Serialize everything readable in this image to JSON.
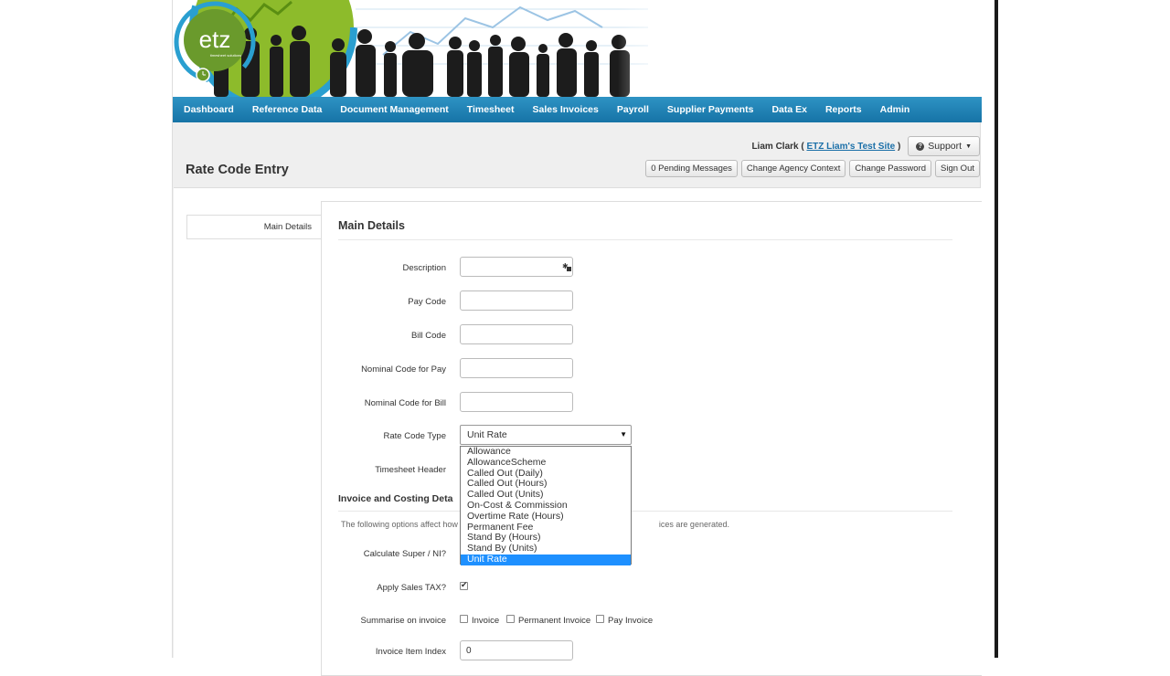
{
  "nav": {
    "items": [
      "Dashboard",
      "Reference Data",
      "Document Management",
      "Timesheet",
      "Sales Invoices",
      "Payroll",
      "Supplier Payments",
      "Data Ex",
      "Reports",
      "Admin"
    ]
  },
  "logo": {
    "text": "etz",
    "tagline": "timesheet solutions"
  },
  "user": {
    "name": "Liam Clark (",
    "site": "ETZ Liam's Test Site",
    "close": ")",
    "support_label": "Support"
  },
  "toolbar": {
    "pending_messages": "0 Pending Messages",
    "change_agency": "Change Agency Context",
    "change_password": "Change Password",
    "sign_out": "Sign Out"
  },
  "page_title": "Rate Code Entry",
  "tab": {
    "main_details": "Main Details"
  },
  "main_details": {
    "heading": "Main Details",
    "fields": {
      "description": {
        "label": "Description",
        "value": ""
      },
      "pay_code": {
        "label": "Pay Code",
        "value": ""
      },
      "bill_code": {
        "label": "Bill Code",
        "value": ""
      },
      "nominal_pay": {
        "label": "Nominal Code for Pay",
        "value": ""
      },
      "nominal_bill": {
        "label": "Nominal Code for Bill",
        "value": ""
      },
      "rate_code_type": {
        "label": "Rate Code Type",
        "value": "Unit Rate"
      },
      "timesheet_header": {
        "label": "Timesheet Header"
      }
    },
    "rate_code_options": [
      "Allowance",
      "AllowanceScheme",
      "Called Out (Daily)",
      "Called Out (Hours)",
      "Called Out (Units)",
      "On-Cost & Commission",
      "Overtime Rate (Hours)",
      "Permanent Fee",
      "Stand By (Hours)",
      "Stand By (Units)",
      "Unit Rate"
    ]
  },
  "invoice": {
    "heading": "Invoice and Costing Deta",
    "info_left": "The following options affect how",
    "info_right": "ices are generated.",
    "calc_super_label": "Calculate Super / NI?",
    "apply_tax_label": "Apply Sales TAX?",
    "summarise_label": "Summarise on invoice",
    "summarise_options": [
      "Invoice",
      "Permanent Invoice",
      "Pay Invoice"
    ],
    "item_index_label": "Invoice Item Index",
    "item_index_value": "0"
  },
  "colors": {
    "nav": "#1f82b7",
    "logo_green": "#6a9a2c",
    "logo_ring": "#2a9fd0",
    "selected": "#1e90ff"
  }
}
